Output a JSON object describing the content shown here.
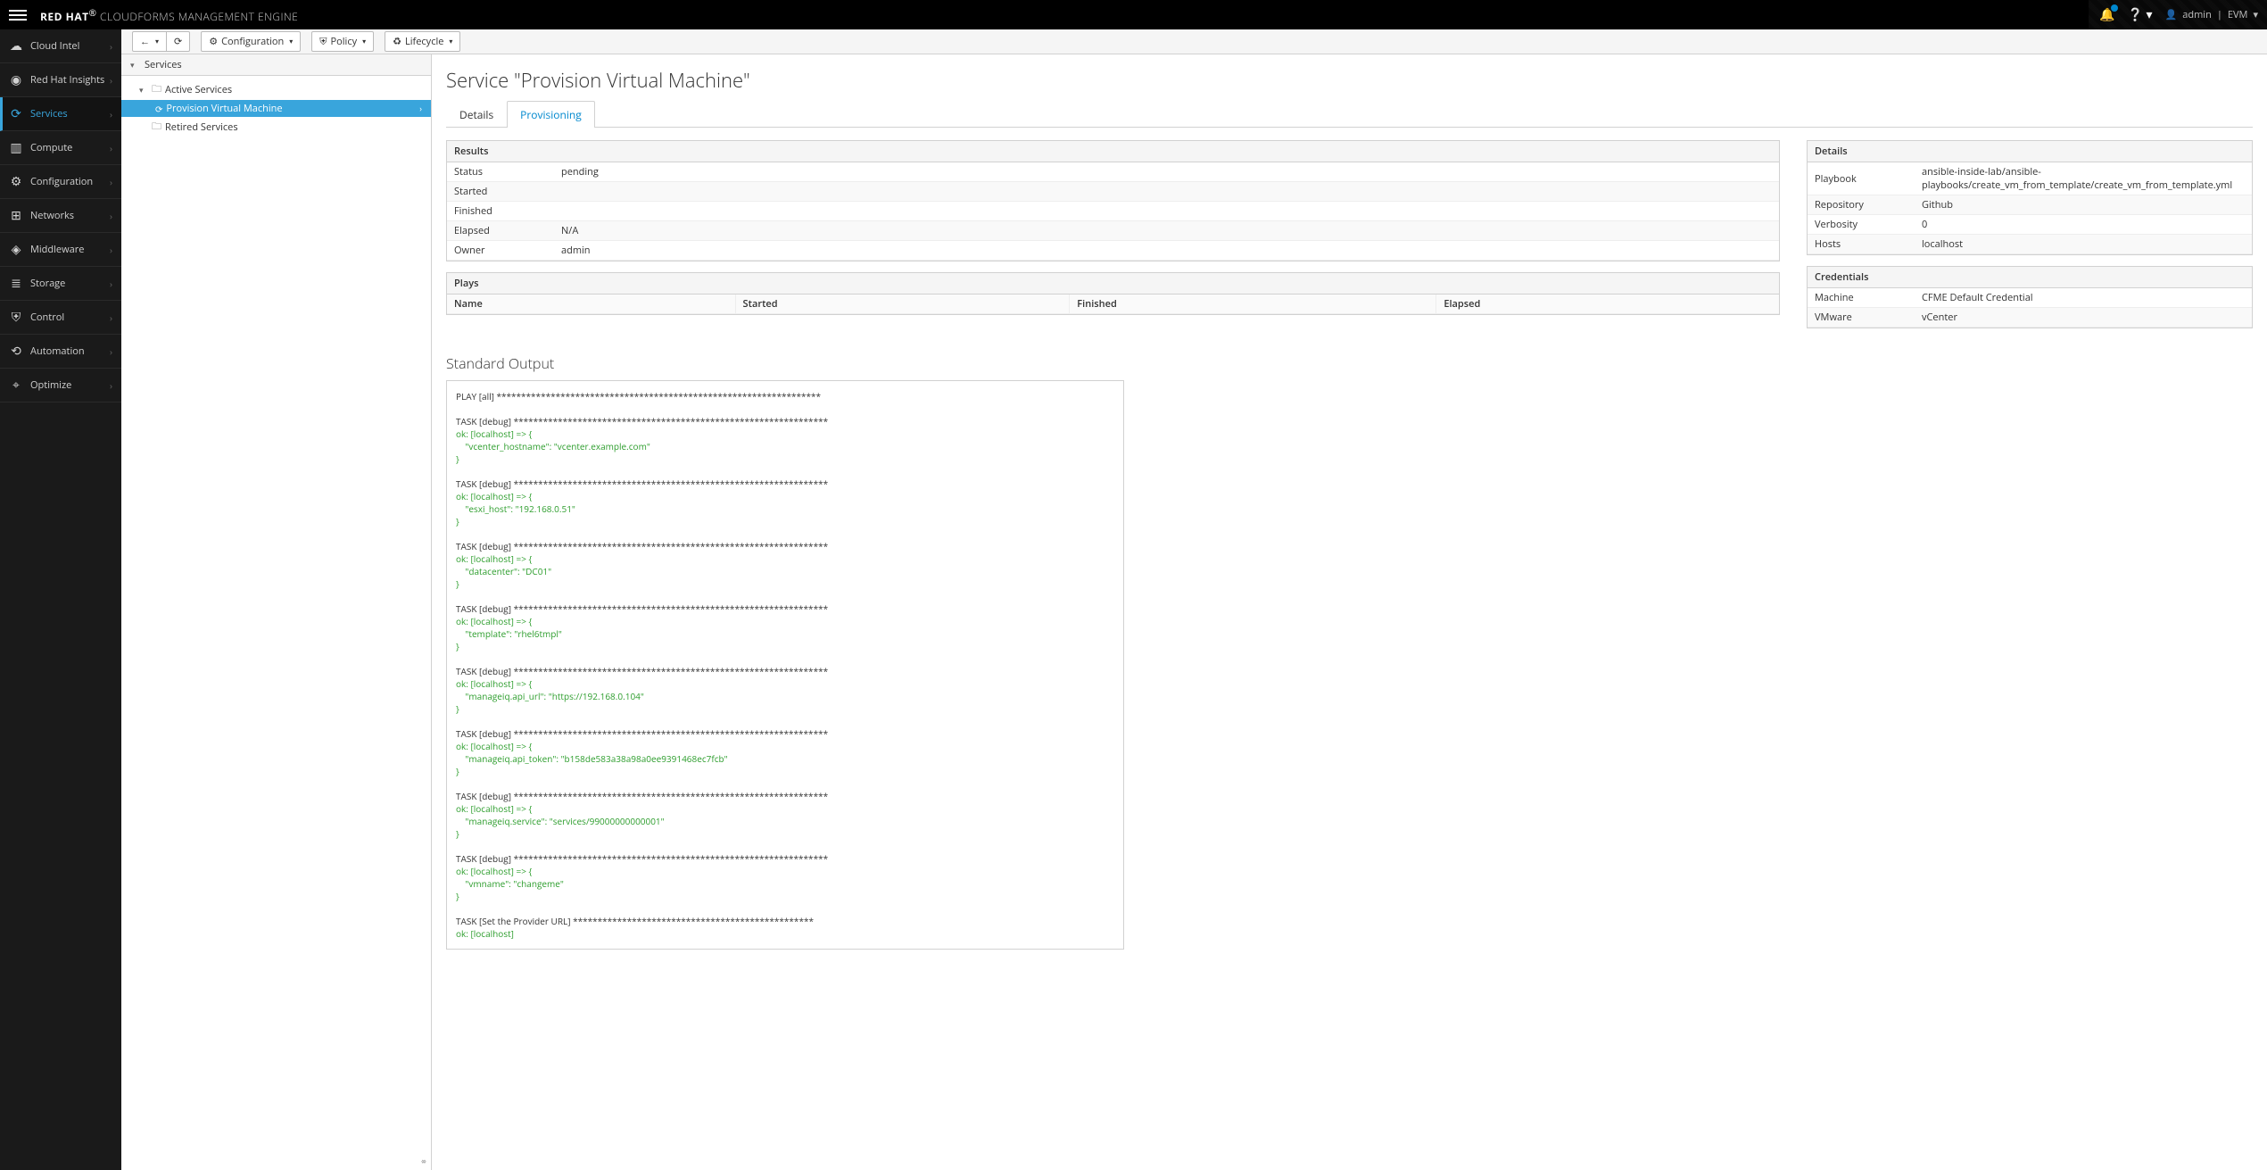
{
  "brand": {
    "rh": "RED HAT",
    "sup": "®",
    "rest": " CLOUDFORMS MANAGEMENT ENGINE"
  },
  "header": {
    "user": "admin",
    "region": "EVM"
  },
  "sidebar": {
    "items": [
      {
        "label": "Cloud Intel",
        "icon": "☁"
      },
      {
        "label": "Red Hat Insights",
        "icon": "◉"
      },
      {
        "label": "Services",
        "icon": "⟳",
        "active": true
      },
      {
        "label": "Compute",
        "icon": "▥"
      },
      {
        "label": "Configuration",
        "icon": "⚙"
      },
      {
        "label": "Networks",
        "icon": "⊞"
      },
      {
        "label": "Middleware",
        "icon": "◈"
      },
      {
        "label": "Storage",
        "icon": "≣"
      },
      {
        "label": "Control",
        "icon": "⛨"
      },
      {
        "label": "Automation",
        "icon": "⟲"
      },
      {
        "label": "Optimize",
        "icon": "⌖"
      }
    ]
  },
  "toolbar": {
    "back": "←",
    "fwd": "→",
    "refresh": "⟳",
    "config_label": "Configuration",
    "policy_label": "Policy",
    "lifecycle_label": "Lifecycle"
  },
  "tree": {
    "root": "Services",
    "active": "Active Services",
    "selected": "Provision Virtual Machine",
    "retired": "Retired Services"
  },
  "page": {
    "title": "Service \"Provision Virtual Machine\"",
    "tabs": {
      "details": "Details",
      "provisioning": "Provisioning"
    }
  },
  "results": {
    "header": "Results",
    "rows": [
      {
        "k": "Status",
        "v": "pending"
      },
      {
        "k": "Started",
        "v": ""
      },
      {
        "k": "Finished",
        "v": ""
      },
      {
        "k": "Elapsed",
        "v": "N/A"
      },
      {
        "k": "Owner",
        "v": "admin"
      }
    ]
  },
  "plays": {
    "header": "Plays",
    "cols": {
      "name": "Name",
      "started": "Started",
      "finished": "Finished",
      "elapsed": "Elapsed"
    }
  },
  "details": {
    "header": "Details",
    "rows": [
      {
        "k": "Playbook",
        "v": "ansible-inside-lab/ansible-playbooks/create_vm_from_template/create_vm_from_template.yml"
      },
      {
        "k": "Repository",
        "v": "Github"
      },
      {
        "k": "Verbosity",
        "v": "0"
      },
      {
        "k": "Hosts",
        "v": "localhost"
      }
    ]
  },
  "credentials": {
    "header": "Credentials",
    "rows": [
      {
        "k": "Machine",
        "v": "CFME Default Credential"
      },
      {
        "k": "VMware",
        "v": "vCenter"
      }
    ]
  },
  "stdout": {
    "title": "Standard Output",
    "lines": [
      {
        "t": "plain",
        "s": "PLAY [all] ******************************************************************"
      },
      {
        "t": "blank",
        "s": ""
      },
      {
        "t": "plain",
        "s": "TASK [debug] ****************************************************************"
      },
      {
        "t": "ok",
        "s": "ok: [localhost] => {"
      },
      {
        "t": "ok",
        "s": "    \"vcenter_hostname\": \"vcenter.example.com\""
      },
      {
        "t": "ok",
        "s": "}"
      },
      {
        "t": "blank",
        "s": ""
      },
      {
        "t": "plain",
        "s": "TASK [debug] ****************************************************************"
      },
      {
        "t": "ok",
        "s": "ok: [localhost] => {"
      },
      {
        "t": "ok",
        "s": "    \"esxi_host\": \"192.168.0.51\""
      },
      {
        "t": "ok",
        "s": "}"
      },
      {
        "t": "blank",
        "s": ""
      },
      {
        "t": "plain",
        "s": "TASK [debug] ****************************************************************"
      },
      {
        "t": "ok",
        "s": "ok: [localhost] => {"
      },
      {
        "t": "ok",
        "s": "    \"datacenter\": \"DC01\""
      },
      {
        "t": "ok",
        "s": "}"
      },
      {
        "t": "blank",
        "s": ""
      },
      {
        "t": "plain",
        "s": "TASK [debug] ****************************************************************"
      },
      {
        "t": "ok",
        "s": "ok: [localhost] => {"
      },
      {
        "t": "ok",
        "s": "    \"template\": \"rhel6tmpl\""
      },
      {
        "t": "ok",
        "s": "}"
      },
      {
        "t": "blank",
        "s": ""
      },
      {
        "t": "plain",
        "s": "TASK [debug] ****************************************************************"
      },
      {
        "t": "ok",
        "s": "ok: [localhost] => {"
      },
      {
        "t": "ok",
        "s": "    \"manageiq.api_url\": \"https://192.168.0.104\""
      },
      {
        "t": "ok",
        "s": "}"
      },
      {
        "t": "blank",
        "s": ""
      },
      {
        "t": "plain",
        "s": "TASK [debug] ****************************************************************"
      },
      {
        "t": "ok",
        "s": "ok: [localhost] => {"
      },
      {
        "t": "ok",
        "s": "    \"manageiq.api_token\": \"b158de583a38a98a0ee9391468ec7fcb\""
      },
      {
        "t": "ok",
        "s": "}"
      },
      {
        "t": "blank",
        "s": ""
      },
      {
        "t": "plain",
        "s": "TASK [debug] ****************************************************************"
      },
      {
        "t": "ok",
        "s": "ok: [localhost] => {"
      },
      {
        "t": "ok",
        "s": "    \"manageiq.service\": \"services/99000000000001\""
      },
      {
        "t": "ok",
        "s": "}"
      },
      {
        "t": "blank",
        "s": ""
      },
      {
        "t": "plain",
        "s": "TASK [debug] ****************************************************************"
      },
      {
        "t": "ok",
        "s": "ok: [localhost] => {"
      },
      {
        "t": "ok",
        "s": "    \"vmname\": \"changeme\""
      },
      {
        "t": "ok",
        "s": "}"
      },
      {
        "t": "blank",
        "s": ""
      },
      {
        "t": "plain",
        "s": "TASK [Set the Provider URL] *************************************************"
      },
      {
        "t": "ok",
        "s": "ok: [localhost]"
      }
    ]
  }
}
